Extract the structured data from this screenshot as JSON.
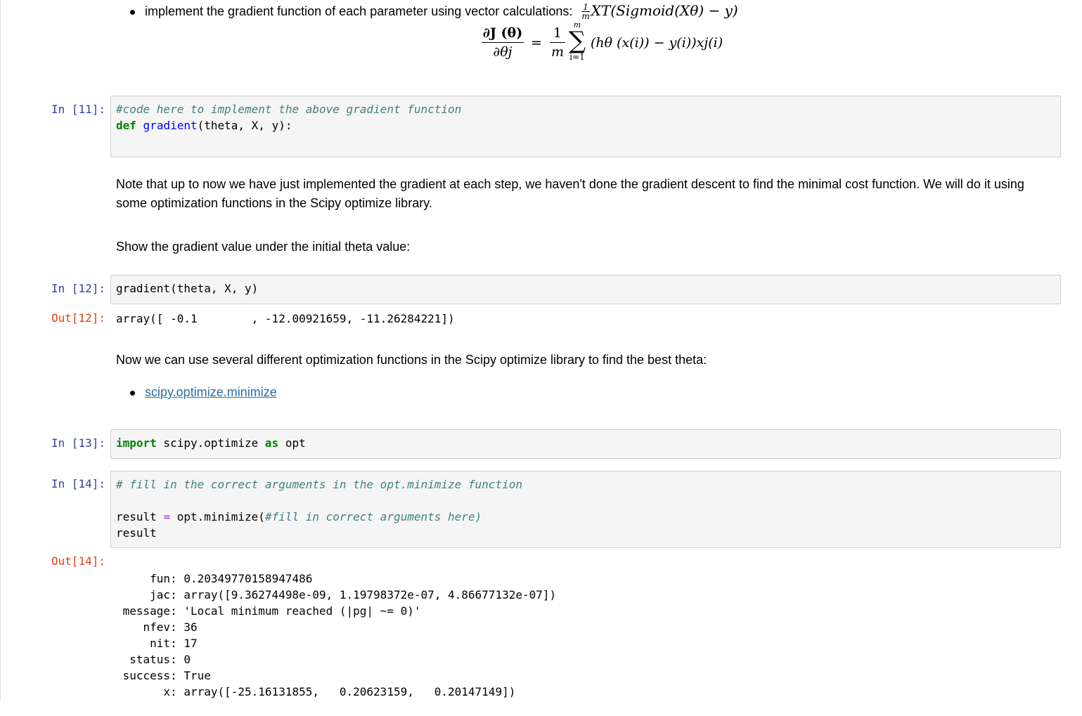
{
  "markdown_top": {
    "bullet_text": "implement the gradient function of each parameter using vector calculations:",
    "inline_formula": "XT(Sigmoid(Xθ) − y)",
    "inline_frac_num": "1",
    "inline_frac_den": "m",
    "display_formula_lhs_num": "∂J (θ)",
    "display_formula_lhs_den": "∂θj",
    "display_formula_eq": "=",
    "display_formula_frac_num": "1",
    "display_formula_frac_den": "m",
    "display_formula_sum_top": "m",
    "display_formula_sum_bottom": "i=1",
    "display_formula_body": "(hθ (x(i)) − y(i))xj(i)"
  },
  "cells": {
    "c11": {
      "prompt": "In [11]:",
      "comment": "#code here to implement the above gradient function",
      "def_kw": "def",
      "fn_name": "gradient",
      "signature": "(theta, X, y):"
    },
    "note1": "Note that up to now we have just implemented the gradient at each step, we haven't done the gradient descent to find the minimal cost function. We will do it using some optimization functions in the Scipy optimize library.",
    "note2": "Show the gradient value under the initial theta value:",
    "c12": {
      "prompt": "In [12]:",
      "code": "gradient(theta, X, y)",
      "out_prompt": "Out[12]:",
      "output": "array([ -0.1        , -12.00921659, -11.26284221])"
    },
    "note3": "Now we can use several different optimization functions in the Scipy optimize library to find the best theta:",
    "link_text": "scipy.optimize.minimize",
    "c13": {
      "prompt": "In [13]:",
      "kw_import": "import",
      "module": " scipy.optimize ",
      "kw_as": "as",
      "alias": " opt"
    },
    "c14": {
      "prompt": "In [14]:",
      "comment": "# fill in the correct arguments in the opt.minimize function",
      "line2_a": "result ",
      "line2_op": "=",
      "line2_b": " opt.minimize(",
      "line2_comment": "#fill in correct arguments here)",
      "line3": "result",
      "out_prompt": "Out[14]:",
      "output_lines": [
        "     fun: 0.20349770158947486",
        "     jac: array([9.36274498e-09, 1.19798372e-07, 4.86677132e-07])",
        " message: 'Local minimum reached (|pg| ~= 0)'",
        "    nfev: 36",
        "     nit: 17",
        "  status: 0",
        " success: True",
        "       x: array([-25.16131855,   0.20623159,   0.20147149])"
      ]
    }
  }
}
